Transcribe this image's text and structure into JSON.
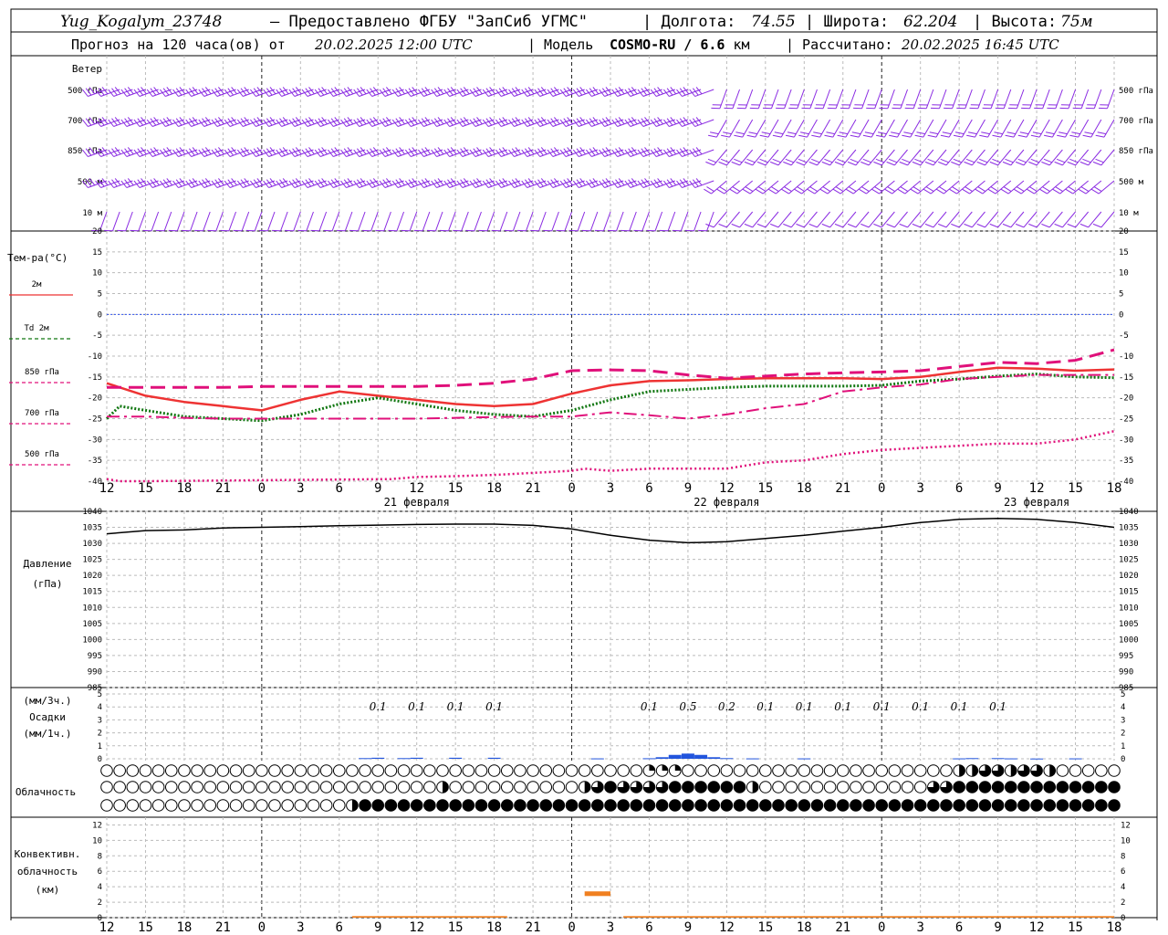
{
  "header": {
    "station": "Yug_Kogalym_23748",
    "provider": "— Предоставлено ФГБУ \"ЗапСиб УГМС\"",
    "lon_label": "| Долгота:",
    "lon": "74.55",
    "lat_label": "| Широта:",
    "lat": "62.204",
    "alt_label": "| Высота:",
    "alt": "75м",
    "forecast_label": "Прогноз на 120 часа(ов) от",
    "forecast_start": "20.02.2025 12:00 UTC",
    "model_label": "| Модель",
    "model": "COSMO-RU / 6.6",
    "model_unit": "км",
    "computed_label": "| Рассчитано:",
    "computed": "20.02.2025 16:45 UTC"
  },
  "wind_panel": {
    "title": "Ветер",
    "levels": [
      "500 гПа",
      "700 гПа",
      "850 гПа",
      "500 м",
      "10 м"
    ]
  },
  "temp_panel": {
    "title": "Тем-ра(°С)",
    "legend": [
      {
        "label": "2м",
        "color": "#ee3333",
        "style": "solid"
      },
      {
        "label": "Td 2м",
        "color": "#117711",
        "style": "dotted"
      },
      {
        "label": "850 гПа",
        "color": "#e0107a",
        "style": "dash"
      },
      {
        "label": "700 гПа",
        "color": "#e0107a",
        "style": "dashdot"
      },
      {
        "label": "500 гПа",
        "color": "#e0107a",
        "style": "dotted"
      }
    ],
    "ticks": [
      20,
      15,
      10,
      5,
      0,
      -5,
      -10,
      -15,
      -20,
      -25,
      -30,
      -35,
      -40
    ]
  },
  "pressure_panel": {
    "title": "Давление",
    "unit": "(гПа)",
    "ticks": [
      1040,
      1035,
      1030,
      1025,
      1020,
      1015,
      1010,
      1005,
      1000,
      995,
      990,
      985
    ]
  },
  "precip_panel": {
    "unit3": "(мм/3ч.)",
    "title": "Осадки",
    "unit1": "(мм/1ч.)",
    "ticks": [
      5,
      4,
      3,
      2,
      1,
      0
    ],
    "labels": [
      {
        "h": 21,
        "v": "0.1"
      },
      {
        "h": 24,
        "v": "0.1"
      },
      {
        "h": 27,
        "v": "0.1"
      },
      {
        "h": 30,
        "v": "0.1"
      },
      {
        "h": 42,
        "v": "0.1"
      },
      {
        "h": 45,
        "v": "0.5"
      },
      {
        "h": 48,
        "v": "0.2"
      },
      {
        "h": 51,
        "v": "0.1"
      },
      {
        "h": 54,
        "v": "0.1"
      },
      {
        "h": 57,
        "v": "0.1"
      },
      {
        "h": 60,
        "v": "0.1"
      },
      {
        "h": 63,
        "v": "0.1"
      },
      {
        "h": 66,
        "v": "0.1"
      },
      {
        "h": 69,
        "v": "0.1"
      }
    ]
  },
  "cloud_panel": {
    "title": "Облачность"
  },
  "conv_panel": {
    "title1": "Конвективн.",
    "title2": "облачность",
    "unit": "(км)",
    "ticks": [
      12,
      10,
      8,
      6,
      4,
      2,
      0
    ]
  },
  "xaxis": {
    "tick_labels": [
      "12",
      "15",
      "18",
      "21",
      "0",
      "3",
      "6",
      "9",
      "12",
      "15",
      "18",
      "21",
      "0",
      "3",
      "6",
      "9",
      "12",
      "15",
      "18",
      "21",
      "0",
      "3",
      "6",
      "9",
      "12",
      "15",
      "18"
    ],
    "days": [
      {
        "h": 24,
        "label": "21 февраля"
      },
      {
        "h": 48,
        "label": "22 февраля"
      },
      {
        "h": 72,
        "label": "23 февраля"
      }
    ]
  },
  "colors": {
    "wind": "#8a2be2",
    "t2m": "#ee3333",
    "td2m": "#117711",
    "upper": "#e0107a",
    "zero_line": "#3355ee",
    "pressure": "#000000",
    "precip": "#2255dd",
    "conv": "#f08020"
  },
  "chart_data": {
    "type": "line",
    "x_unit": "hours from 20.02.2025 12:00 UTC",
    "xlim": [
      0,
      78
    ],
    "temperature": {
      "ylim": [
        -40,
        20
      ],
      "series": [
        {
          "name": "2м",
          "x": [
            0,
            3,
            6,
            9,
            12,
            15,
            18,
            21,
            24,
            27,
            30,
            33,
            36,
            39,
            42,
            45,
            48,
            51,
            54,
            57,
            60,
            63,
            66,
            69,
            72,
            75,
            78
          ],
          "values": [
            -16.5,
            -19.5,
            -21,
            -22,
            -23,
            -20.5,
            -18.5,
            -19.5,
            -20.5,
            -21.5,
            -22,
            -21.5,
            -19,
            -17,
            -16,
            -15.8,
            -15.5,
            -15.3,
            -15.3,
            -15.3,
            -15.5,
            -15,
            -13.8,
            -12.8,
            -13,
            -13.5,
            -13.2
          ]
        },
        {
          "name": "Td 2м",
          "x": [
            0,
            1,
            3,
            6,
            9,
            12,
            15,
            18,
            21,
            24,
            27,
            30,
            33,
            36,
            39,
            42,
            45,
            48,
            51,
            54,
            57,
            60,
            63,
            66,
            69,
            72,
            75,
            78
          ],
          "values": [
            -25,
            -22,
            -23,
            -24.5,
            -25,
            -25.5,
            -24,
            -21.5,
            -20,
            -21.5,
            -23,
            -24,
            -24.5,
            -23,
            -20.5,
            -18.5,
            -18,
            -17.5,
            -17.2,
            -17.2,
            -17.2,
            -17,
            -16,
            -15.5,
            -14.8,
            -14.3,
            -15,
            -15.2
          ]
        },
        {
          "name": "850 гПа",
          "x": [
            0,
            3,
            6,
            9,
            12,
            15,
            18,
            21,
            24,
            27,
            30,
            33,
            36,
            39,
            42,
            45,
            48,
            51,
            54,
            57,
            60,
            63,
            66,
            69,
            72,
            75,
            78
          ],
          "values": [
            -17.5,
            -17.5,
            -17.5,
            -17.5,
            -17.3,
            -17.3,
            -17.3,
            -17.3,
            -17.3,
            -17,
            -16.5,
            -15.5,
            -13.5,
            -13.3,
            -13.5,
            -14.5,
            -15.3,
            -14.8,
            -14.3,
            -14,
            -13.8,
            -13.5,
            -12.5,
            -11.5,
            -11.8,
            -11,
            -8.5
          ]
        },
        {
          "name": "700 гПа",
          "x": [
            0,
            3,
            6,
            9,
            12,
            15,
            18,
            21,
            24,
            27,
            30,
            33,
            36,
            39,
            42,
            45,
            48,
            51,
            54,
            57,
            60,
            63,
            66,
            69,
            72,
            75,
            78
          ],
          "values": [
            -24.5,
            -24.5,
            -24.8,
            -25,
            -25,
            -25,
            -25,
            -25,
            -25,
            -24.8,
            -24.6,
            -24.5,
            -24.5,
            -23.5,
            -24.2,
            -25,
            -24,
            -22.5,
            -21.5,
            -18.5,
            -17.5,
            -16.8,
            -15.5,
            -15,
            -14.5,
            -14.5,
            -14.5
          ]
        },
        {
          "name": "500 гПа",
          "x": [
            0,
            1,
            3,
            22,
            24,
            27,
            30,
            33,
            36,
            37,
            39,
            42,
            45,
            48,
            51,
            54,
            57,
            60,
            63,
            66,
            69,
            72,
            75,
            78
          ],
          "values": [
            -39.5,
            -40,
            -40,
            -39.5,
            -39,
            -38.8,
            -38.5,
            -38,
            -37.5,
            -37,
            -37.5,
            -37,
            -37,
            -37,
            -35.5,
            -35,
            -33.5,
            -32.5,
            -32,
            -31.5,
            -31,
            -31,
            -30,
            -28
          ]
        }
      ]
    },
    "pressure": {
      "ylim": [
        985,
        1040
      ],
      "series": [
        {
          "name": "Давление",
          "x": [
            0,
            3,
            6,
            9,
            12,
            15,
            18,
            21,
            24,
            27,
            30,
            33,
            36,
            39,
            42,
            45,
            48,
            51,
            54,
            57,
            60,
            63,
            66,
            69,
            72,
            75,
            78
          ],
          "values": [
            1033,
            1034,
            1034.2,
            1034.8,
            1035,
            1035.2,
            1035.5,
            1035.7,
            1035.9,
            1036,
            1036,
            1035.6,
            1034.5,
            1032.5,
            1031,
            1030.2,
            1030.5,
            1031.5,
            1032.5,
            1033.8,
            1035,
            1036.5,
            1037.5,
            1037.8,
            1037.5,
            1036.5,
            1035
          ]
        }
      ]
    },
    "precipitation_mm_per_h": {
      "ylim": [
        0,
        5
      ],
      "x": [
        20,
        21,
        23,
        24,
        27,
        30,
        38,
        42,
        43,
        44,
        45,
        46,
        47,
        48,
        50,
        54,
        66,
        67,
        69,
        70,
        72,
        75
      ],
      "values": [
        0.05,
        0.08,
        0.05,
        0.08,
        0.08,
        0.08,
        0.03,
        0.04,
        0.12,
        0.3,
        0.4,
        0.3,
        0.12,
        0.05,
        0.03,
        0.03,
        0.03,
        0.05,
        0.05,
        0.03,
        0.02,
        0.03
      ]
    },
    "cloud_cover_octas": {
      "layers": [
        "high",
        "middle",
        "low"
      ],
      "high": {
        "x": [
          42,
          43,
          44,
          66,
          67,
          68,
          69,
          70,
          71,
          72,
          73
        ],
        "octas": [
          2,
          2,
          2,
          4,
          4,
          6,
          6,
          4,
          6,
          6,
          4
        ]
      },
      "middle": {
        "x": [
          26,
          37,
          38,
          39,
          40,
          41,
          42,
          43,
          44,
          45,
          46,
          47,
          48,
          49,
          50,
          64,
          65,
          66,
          67,
          68,
          69,
          70,
          71,
          72,
          73,
          74,
          75,
          76,
          77,
          78
        ],
        "octas": [
          4,
          4,
          6,
          8,
          6,
          6,
          6,
          6,
          8,
          8,
          8,
          8,
          8,
          8,
          4,
          6,
          6,
          8,
          8,
          8,
          8,
          8,
          8,
          8,
          8,
          8,
          8,
          8,
          8,
          8
        ]
      },
      "low": {
        "x_from": 19,
        "x_to": 78,
        "octas": 8,
        "transition": {
          "x": 19,
          "octas": 4
        }
      }
    },
    "convective_cloud_km": {
      "ylim": [
        0,
        13
      ],
      "segments": [
        {
          "x0": 19,
          "x1": 31,
          "base": 0,
          "top": 0.2
        },
        {
          "x0": 37,
          "x1": 39,
          "base": 2.8,
          "top": 3.4
        },
        {
          "x0": 40,
          "x1": 78,
          "base": 0,
          "top": 0.2
        }
      ]
    },
    "wind": {
      "levels": [
        "500 гПа",
        "700 гПа",
        "850 гПа",
        "500 м",
        "10 м"
      ],
      "time_step_h": 1,
      "direction_deg_approx": [
        {
          "level": "500 гПа",
          "dir": 250,
          "later_dir": 200
        },
        {
          "level": "700 гПа",
          "dir": 250,
          "later_dir": 210
        },
        {
          "level": "850 гПа",
          "dir": 250,
          "later_dir": 220
        },
        {
          "level": "500 м",
          "dir": 250,
          "later_dir": 230
        },
        {
          "level": "10 м",
          "dir": 200,
          "later_dir": 220
        }
      ]
    }
  }
}
